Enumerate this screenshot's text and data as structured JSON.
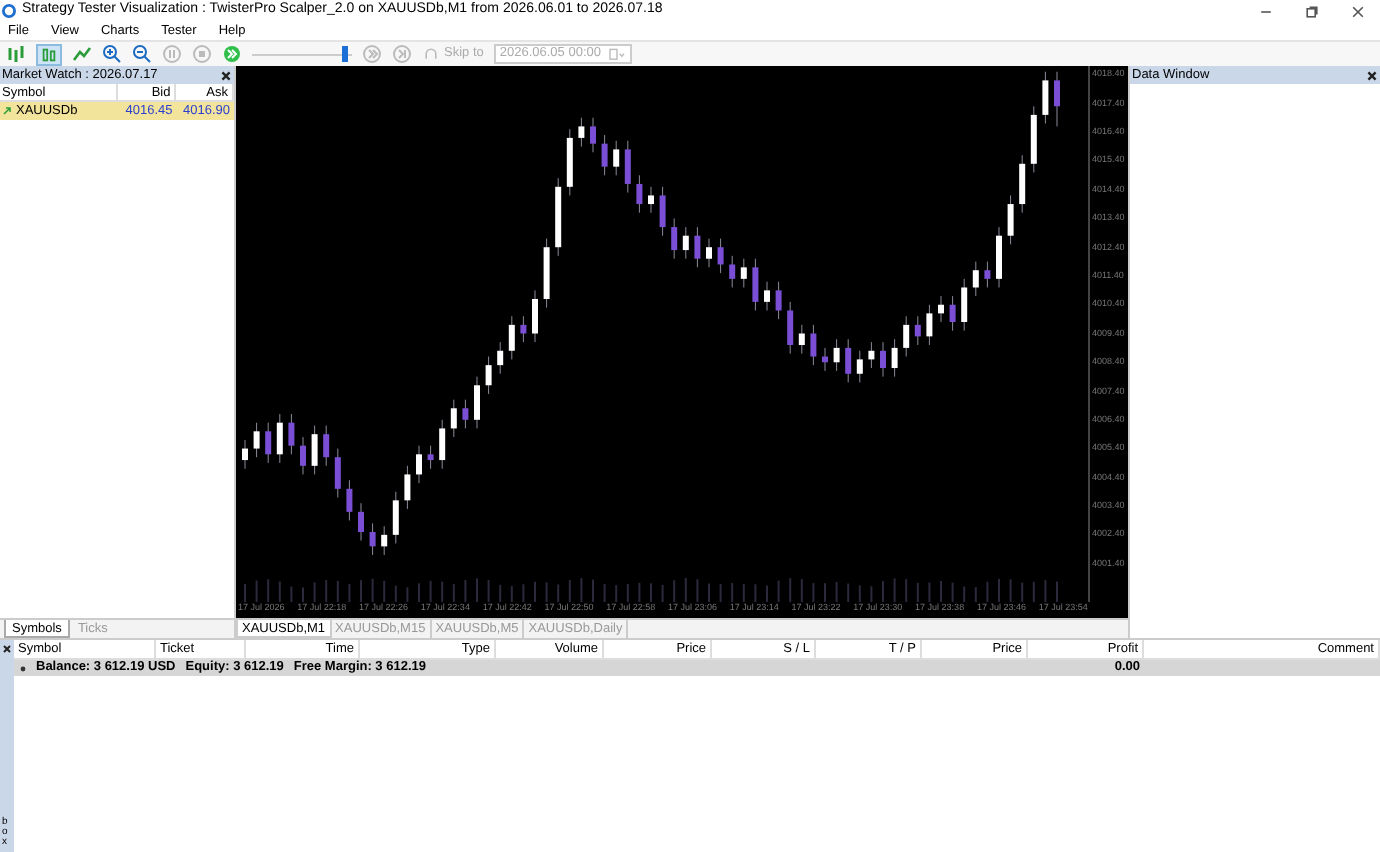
{
  "window": {
    "title": "Strategy Tester Visualization : TwisterPro Scalper_2.0 on XAUUSDb,M1 from 2026.06.01 to 2026.07.18"
  },
  "menu": [
    "File",
    "View",
    "Charts",
    "Tester",
    "Help"
  ],
  "toolbar": {
    "speed": {
      "level": 0.95
    },
    "skip_label": "Skip to",
    "date_value": "2026.06.05 00:00"
  },
  "market_watch": {
    "title": "Market Watch : 2026.07.17",
    "columns": [
      "Symbol",
      "Bid",
      "Ask"
    ],
    "rows": [
      {
        "symbol": "XAUUSDb",
        "bid": "4016.45",
        "ask": "4016.90",
        "selected": true
      }
    ],
    "tabs": [
      {
        "label": "Symbols",
        "selected": true
      },
      {
        "label": "Ticks",
        "selected": false
      }
    ]
  },
  "chart": {
    "chart_data": {
      "type": "candlestick",
      "ylim": [
        4000.9,
        4018.7
      ],
      "yticks": [
        {
          "value": 4018.4,
          "label": "4018.40"
        },
        {
          "value": 4017.4,
          "label": "4017.40"
        },
        {
          "value": 4016.4,
          "label": "4016.40"
        },
        {
          "value": 4015.4,
          "label": "4015.40"
        },
        {
          "value": 4014.4,
          "label": "4014.40"
        },
        {
          "value": 4013.4,
          "label": "4013.40"
        },
        {
          "value": 4012.4,
          "label": "4012.40"
        },
        {
          "value": 4011.4,
          "label": "4011.40"
        },
        {
          "value": 4010.4,
          "label": "4010.40"
        },
        {
          "value": 4009.4,
          "label": "4009.40"
        },
        {
          "value": 4008.4,
          "label": "4008.40"
        },
        {
          "value": 4007.4,
          "label": "4007.40"
        },
        {
          "value": 4006.4,
          "label": "4006.40"
        },
        {
          "value": 4005.4,
          "label": "4005.40"
        },
        {
          "value": 4004.4,
          "label": "4004.40"
        },
        {
          "value": 4003.4,
          "label": "4003.40"
        },
        {
          "value": 4002.4,
          "label": "4002.40"
        },
        {
          "value": 4001.4,
          "label": "4001.40"
        }
      ],
      "categories": [
        null,
        null,
        null,
        null,
        null,
        null,
        null,
        null,
        null,
        null,
        null,
        null,
        null,
        null,
        null,
        null,
        null,
        null,
        null,
        null,
        null,
        null,
        null,
        null,
        null,
        null,
        null,
        null,
        null,
        null,
        null,
        null,
        null,
        null,
        null,
        null,
        null,
        null,
        null,
        null,
        null,
        null,
        null,
        null,
        null,
        null,
        null,
        null,
        null,
        null,
        null,
        null,
        null,
        null,
        null,
        null,
        null,
        null,
        null,
        null,
        null,
        null,
        null,
        null,
        null,
        null,
        null,
        null,
        null,
        null,
        null
      ],
      "ohlc": [
        [
          4005.0,
          4005.7,
          4004.7,
          4005.4
        ],
        [
          4005.4,
          4006.3,
          4005.1,
          4006.0
        ],
        [
          4006.0,
          4006.3,
          4004.9,
          4005.2
        ],
        [
          4005.2,
          4006.6,
          4004.9,
          4006.3
        ],
        [
          4006.3,
          4006.6,
          4005.2,
          4005.5
        ],
        [
          4005.5,
          4005.8,
          4004.5,
          4004.8
        ],
        [
          4004.8,
          4006.2,
          4004.5,
          4005.9
        ],
        [
          4005.9,
          4006.2,
          4004.8,
          4005.1
        ],
        [
          4005.1,
          4005.4,
          4003.7,
          4004.0
        ],
        [
          4004.0,
          4004.3,
          4002.9,
          4003.2
        ],
        [
          4003.2,
          4003.5,
          4002.2,
          4002.5
        ],
        [
          4002.5,
          4002.8,
          4001.7,
          4002.0
        ],
        [
          4002.0,
          4002.7,
          4001.7,
          4002.4
        ],
        [
          4002.4,
          4003.9,
          4002.1,
          4003.6
        ],
        [
          4003.6,
          4004.8,
          4003.3,
          4004.5
        ],
        [
          4004.5,
          4005.5,
          4004.2,
          4005.2
        ],
        [
          4005.2,
          4005.5,
          4004.7,
          4005.0
        ],
        [
          4005.0,
          4006.4,
          4004.7,
          4006.1
        ],
        [
          4006.1,
          4007.1,
          4005.8,
          4006.8
        ],
        [
          4006.8,
          4007.1,
          4006.1,
          4006.4
        ],
        [
          4006.4,
          4007.9,
          4006.1,
          4007.6
        ],
        [
          4007.6,
          4008.6,
          4007.3,
          4008.3
        ],
        [
          4008.3,
          4009.1,
          4008.0,
          4008.8
        ],
        [
          4008.8,
          4010.0,
          4008.5,
          4009.7
        ],
        [
          4009.7,
          4010.0,
          4009.1,
          4009.4
        ],
        [
          4009.4,
          4010.9,
          4009.1,
          4010.6
        ],
        [
          4010.6,
          4012.7,
          4010.3,
          4012.4
        ],
        [
          4012.4,
          4014.8,
          4012.1,
          4014.5
        ],
        [
          4014.5,
          4016.5,
          4014.2,
          4016.2
        ],
        [
          4016.2,
          4016.9,
          4015.9,
          4016.6
        ],
        [
          4016.6,
          4016.9,
          4015.7,
          4016.0
        ],
        [
          4016.0,
          4016.3,
          4014.9,
          4015.2
        ],
        [
          4015.2,
          4016.1,
          4014.9,
          4015.8
        ],
        [
          4015.8,
          4016.1,
          4014.3,
          4014.6
        ],
        [
          4014.6,
          4014.9,
          4013.6,
          4013.9
        ],
        [
          4013.9,
          4014.5,
          4013.6,
          4014.2
        ],
        [
          4014.2,
          4014.5,
          4012.8,
          4013.1
        ],
        [
          4013.1,
          4013.4,
          4012.0,
          4012.3
        ],
        [
          4012.3,
          4013.1,
          4012.0,
          4012.8
        ],
        [
          4012.8,
          4013.1,
          4011.7,
          4012.0
        ],
        [
          4012.0,
          4012.7,
          4011.7,
          4012.4
        ],
        [
          4012.4,
          4012.7,
          4011.5,
          4011.8
        ],
        [
          4011.8,
          4012.1,
          4011.0,
          4011.3
        ],
        [
          4011.3,
          4012.0,
          4011.0,
          4011.7
        ],
        [
          4011.7,
          4012.0,
          4010.2,
          4010.5
        ],
        [
          4010.5,
          4011.2,
          4010.2,
          4010.9
        ],
        [
          4010.9,
          4011.2,
          4009.9,
          4010.2
        ],
        [
          4010.2,
          4010.5,
          4008.7,
          4009.0
        ],
        [
          4009.0,
          4009.7,
          4008.7,
          4009.4
        ],
        [
          4009.4,
          4009.7,
          4008.3,
          4008.6
        ],
        [
          4008.6,
          4008.9,
          4008.1,
          4008.4
        ],
        [
          4008.4,
          4009.2,
          4008.1,
          4008.9
        ],
        [
          4008.9,
          4009.2,
          4007.7,
          4008.0
        ],
        [
          4008.0,
          4008.8,
          4007.7,
          4008.5
        ],
        [
          4008.5,
          4009.1,
          4008.2,
          4008.8
        ],
        [
          4008.8,
          4009.1,
          4007.9,
          4008.2
        ],
        [
          4008.2,
          4009.2,
          4007.9,
          4008.9
        ],
        [
          4008.9,
          4010.0,
          4008.6,
          4009.7
        ],
        [
          4009.7,
          4010.0,
          4009.0,
          4009.3
        ],
        [
          4009.3,
          4010.4,
          4009.0,
          4010.1
        ],
        [
          4010.1,
          4010.7,
          4009.8,
          4010.4
        ],
        [
          4010.4,
          4010.7,
          4009.5,
          4009.8
        ],
        [
          4009.8,
          4011.3,
          4009.5,
          4011.0
        ],
        [
          4011.0,
          4011.9,
          4010.7,
          4011.6
        ],
        [
          4011.6,
          4011.9,
          4011.0,
          4011.3
        ],
        [
          4011.3,
          4013.1,
          4011.0,
          4012.8
        ],
        [
          4012.8,
          4014.2,
          4012.5,
          4013.9
        ],
        [
          4013.9,
          4015.6,
          4013.6,
          4015.3
        ],
        [
          4015.3,
          4017.3,
          4015.0,
          4017.0
        ],
        [
          4017.0,
          4018.5,
          4016.7,
          4018.2
        ],
        [
          4018.2,
          4018.5,
          4016.6,
          4017.3
        ]
      ]
    },
    "time_labels": [
      "17 Jul 2026",
      "17 Jul 22:18",
      "17 Jul 22:26",
      "17 Jul 22:34",
      "17 Jul 22:42",
      "17 Jul 22:50",
      "17 Jul 22:58",
      "17 Jul 23:06",
      "17 Jul 23:14",
      "17 Jul 23:22",
      "17 Jul 23:30",
      "17 Jul 23:38",
      "17 Jul 23:46",
      "17 Jul 23:54"
    ],
    "tabs": [
      {
        "label": "XAUUSDb,M1",
        "selected": true
      },
      {
        "label": "XAUUSDb,M15",
        "selected": false
      },
      {
        "label": "XAUUSDb,M5",
        "selected": false
      },
      {
        "label": "XAUUSDb,Daily",
        "selected": false
      }
    ]
  },
  "data_window": {
    "title": "Data Window"
  },
  "trade_table": {
    "columns": [
      "Symbol",
      "Ticket",
      "Time",
      "Type",
      "Volume",
      "Price",
      "S / L",
      "T / P",
      "Price",
      "Profit",
      "Comment"
    ],
    "summary": {
      "balance": "Balance: 3 612.19 USD",
      "equity": "Equity: 3 612.19",
      "free_margin": "Free Margin: 3 612.19",
      "profit": "0.00"
    }
  },
  "toolbox": {
    "label": "box"
  }
}
